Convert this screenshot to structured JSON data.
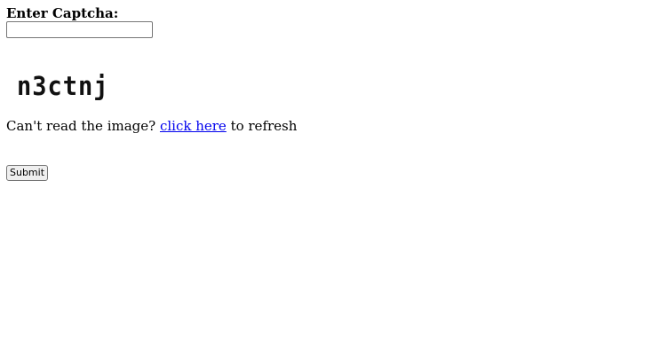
{
  "form": {
    "label": "Enter Captcha:",
    "input_value": "",
    "captcha_text": "n3ctnj",
    "refresh_prefix": "Can't read the image? ",
    "refresh_link": "click here",
    "refresh_suffix": " to refresh",
    "submit_label": "Submit"
  },
  "colors": {
    "link": "#0000ee",
    "button_bg": "#efefef",
    "border": "#767676"
  }
}
